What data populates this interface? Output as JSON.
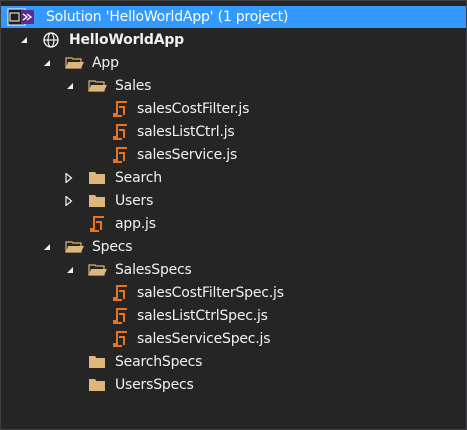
{
  "solution": {
    "title": "Solution 'HelloWorldApp' (1 project)",
    "icon": "solution-icon"
  },
  "tree": [
    {
      "id": "project",
      "label": "HelloWorldApp",
      "icon": "globe-project-icon",
      "toggle": "expanded",
      "bold": true
    },
    {
      "id": "app",
      "label": "App",
      "icon": "folder-open-icon",
      "toggle": "expanded"
    },
    {
      "id": "sales",
      "label": "Sales",
      "icon": "folder-open-icon",
      "toggle": "expanded"
    },
    {
      "id": "salesCostFilter",
      "label": "salesCostFilter.js",
      "icon": "js-file-icon"
    },
    {
      "id": "salesListCtrl",
      "label": "salesListCtrl.js",
      "icon": "js-file-icon"
    },
    {
      "id": "salesService",
      "label": "salesService.js",
      "icon": "js-file-icon"
    },
    {
      "id": "search",
      "label": "Search",
      "icon": "folder-icon",
      "toggle": "collapsed"
    },
    {
      "id": "users",
      "label": "Users",
      "icon": "folder-icon",
      "toggle": "collapsed"
    },
    {
      "id": "appjs",
      "label": "app.js",
      "icon": "js-file-icon"
    },
    {
      "id": "specs",
      "label": "Specs",
      "icon": "folder-open-icon",
      "toggle": "expanded"
    },
    {
      "id": "salesSpecs",
      "label": "SalesSpecs",
      "icon": "folder-open-icon",
      "toggle": "expanded"
    },
    {
      "id": "salesCostFilterSpec",
      "label": "salesCostFilterSpec.js",
      "icon": "js-file-icon"
    },
    {
      "id": "salesListCtrlSpec",
      "label": "salesListCtrlSpec.js",
      "icon": "js-file-icon"
    },
    {
      "id": "salesServiceSpec",
      "label": "salesServiceSpec.js",
      "icon": "js-file-icon"
    },
    {
      "id": "searchSpecs",
      "label": "SearchSpecs",
      "icon": "folder-icon"
    },
    {
      "id": "usersSpecs",
      "label": "UsersSpecs",
      "icon": "folder-icon"
    }
  ],
  "colors": {
    "background": "#252526",
    "selection": "#3399ff",
    "folder": "#dcb67a",
    "js_icon": "#e8741e",
    "text": "#f1f1f1"
  }
}
